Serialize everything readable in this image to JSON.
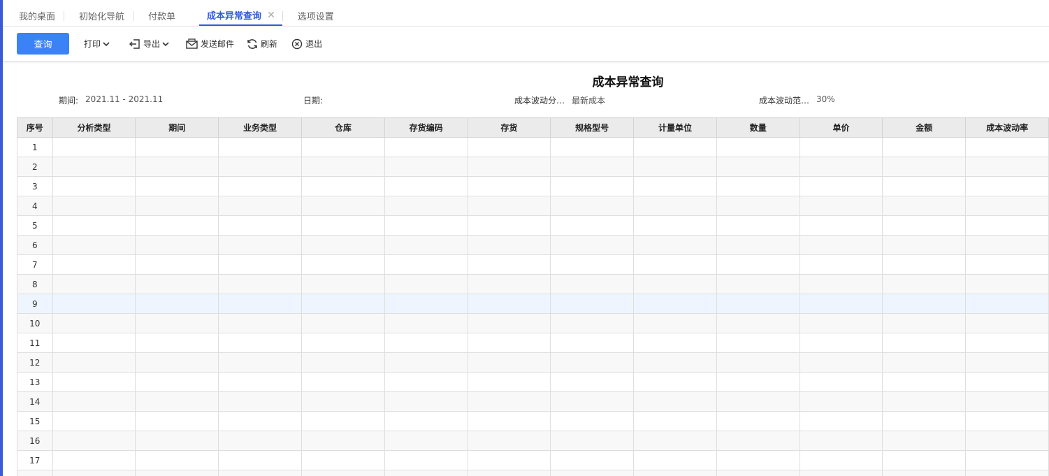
{
  "tabs": [
    {
      "label": "我的桌面"
    },
    {
      "label": "初始化导航"
    },
    {
      "label": "付款单"
    },
    {
      "label": "成本异常查询",
      "active": true
    },
    {
      "label": "选项设置"
    }
  ],
  "toolbar": {
    "query": "查询",
    "print": "打印",
    "export": "导出",
    "send_mail": "发送邮件",
    "refresh": "刷新",
    "exit": "退出"
  },
  "report": {
    "title": "成本异常查询",
    "filters": {
      "period_label": "期间:",
      "period_value": "2021.11 - 2021.11",
      "date_label": "日期:",
      "date_value": "",
      "fluct_analysis_label": "成本波动分…",
      "fluct_analysis_value": "最新成本",
      "fluct_range_label": "成本波动范…",
      "fluct_range_value": "30%"
    }
  },
  "table": {
    "columns": [
      "序号",
      "分析类型",
      "期间",
      "业务类型",
      "仓库",
      "存货编码",
      "存货",
      "规格型号",
      "计量单位",
      "数量",
      "单价",
      "金额",
      "成本波动率"
    ],
    "rows": [
      "1",
      "2",
      "3",
      "4",
      "5",
      "6",
      "7",
      "8",
      "9",
      "10",
      "11",
      "12",
      "13",
      "14",
      "15",
      "16",
      "17",
      ""
    ],
    "highlighted_row": "9"
  },
  "colors": {
    "accent": "#2f5bd6",
    "primary_button": "#3b82f6",
    "header_bg": "#ebebeb"
  }
}
